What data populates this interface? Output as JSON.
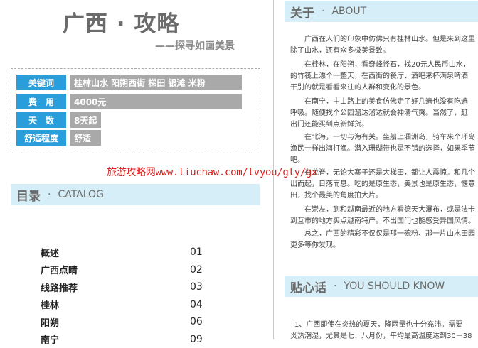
{
  "title": "广西 · 攻略",
  "subtitle": "——探寻如画美景",
  "keywords_table": [
    {
      "key": "关键词",
      "value": "桂林山水 阳朔西街 梯田 银滩 米粉"
    },
    {
      "key": "费　用",
      "value": "4000元"
    },
    {
      "key": "天　数",
      "value": "8天起"
    },
    {
      "key": "舒适程度",
      "value": "舒适"
    }
  ],
  "watermark": "旅游攻略网www.liuchaw.com/lvyou/gly/gx",
  "catalog": {
    "title_zh": "目录",
    "dot": "·",
    "title_en": "CATALOG",
    "items": [
      {
        "label": "概述",
        "page": "01"
      },
      {
        "label": "广西点睛",
        "page": "02"
      },
      {
        "label": "线路推荐",
        "page": "03"
      },
      {
        "label": "桂林",
        "page": "04"
      },
      {
        "label": "阳朔",
        "page": "06"
      },
      {
        "label": "南宁",
        "page": "09"
      }
    ]
  },
  "about": {
    "title_zh": "关于",
    "dot": "·",
    "title_en": "ABOUT",
    "paragraphs": [
      [
        "广西在人们的印象中仿佛只有桂林山水。但是来到这里",
        "除了山水，还有众多极美景致。"
      ],
      [
        "在桂林，在阳朔，看奇峰怪石，找20元人民币山水，",
        "的竹筏上漂个一整天，在西街的餐厅、酒吧来杯满泉啤酒",
        "干别的就是看看来往的人群和变化的景色。"
      ],
      [
        "在南宁，中山路上的美食仿佛走了好几遍也没有吃遍",
        "呼吸。随便找个公园溜达溜达就会神清气爽。当然了，赶",
        "出门还能买到点新鲜货。"
      ],
      [
        "在北海，一切与海有关。坐船上涠洲岛，骑车来个环岛",
        "渔民一样出海打渔。潜入珊瑚带也是不错的选择，如果季节",
        "吧。"
      ],
      [
        "在龙脊，无论大寨子还是大梯田，都让人震惊。和几个",
        "出而起，日落而息。吃的是原生态，美景也是原生态，惬意",
        "田，找个最美的角度拍大片。"
      ],
      [
        "在崇左，到和越南最近的地方看德天大瀑布，或是法卡",
        "到互市的地方买点越南特产。不出国门也能感受异国风情。"
      ],
      [
        "总之，广西的精彩不仅仅是那一碗粉、那一片山水田园",
        "更多等你发现。"
      ]
    ]
  },
  "tips": {
    "title_zh": "贴心话",
    "dot": "·",
    "title_en": "YOU SHOULD KNOW",
    "lines": [
      "1、广西即使在炎热的夏天，降雨量也十分充沛。需要",
      "炎热潮湿，尤其是七、八月份，平均最高温度达到30－38"
    ]
  },
  "colors": {
    "accent": "#2a9ddb",
    "section_bg": "#d6eef7",
    "value_bg": "#a9a9a9",
    "watermark": "#d81e1e"
  }
}
